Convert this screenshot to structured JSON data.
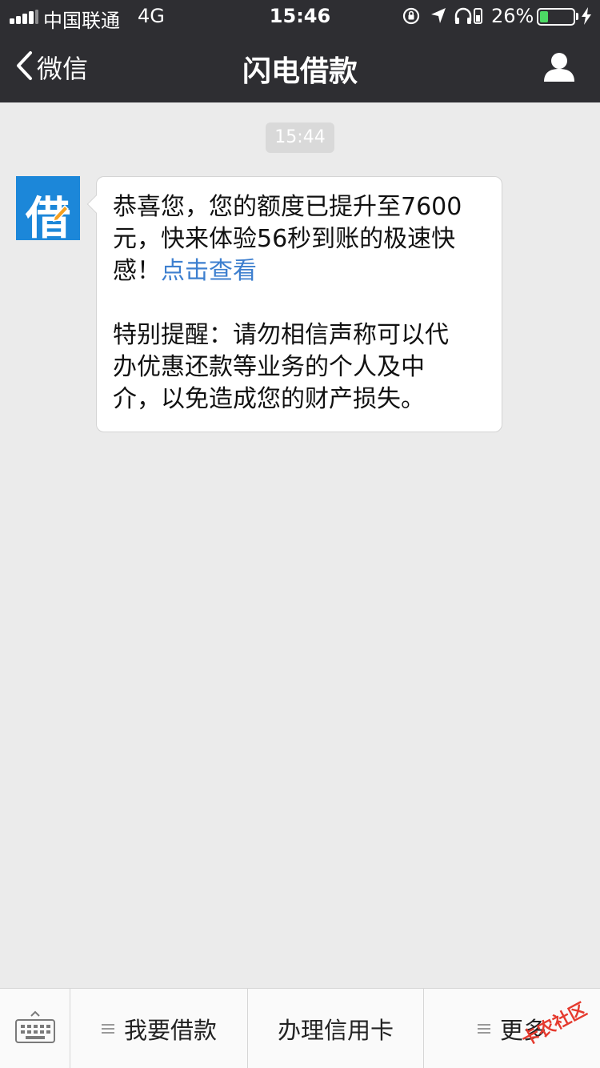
{
  "status_bar": {
    "carrier": "中国联通",
    "network": "4G",
    "time": "15:46",
    "battery_percent": "26%",
    "battery_level": 0.26,
    "battery_color": "#4cd964"
  },
  "nav": {
    "back_label": "微信",
    "title": "闪电借款",
    "back_icon": "chevron-left-icon",
    "profile_icon": "person-icon"
  },
  "chat": {
    "timestamp": "15:44",
    "avatar_char": "借",
    "avatar_color": "#1c87d9",
    "message": {
      "line1": "恭喜您，您的额度已提升至7600",
      "line2": "元，快来体验56秒到账的极速快",
      "line3_prefix": "感！",
      "link": "点击查看",
      "line4": "特别提醒：请勿相信声称可以代",
      "line5": "办优惠还款等业务的个人及中",
      "line6": "介，以免造成您的财产损失。"
    }
  },
  "bottom_menu": {
    "keyboard_icon": "keyboard-icon",
    "items": [
      {
        "label": "我要借款"
      },
      {
        "label": "办理信用卡"
      },
      {
        "label": "更多"
      }
    ]
  },
  "watermark": "卡农社区"
}
